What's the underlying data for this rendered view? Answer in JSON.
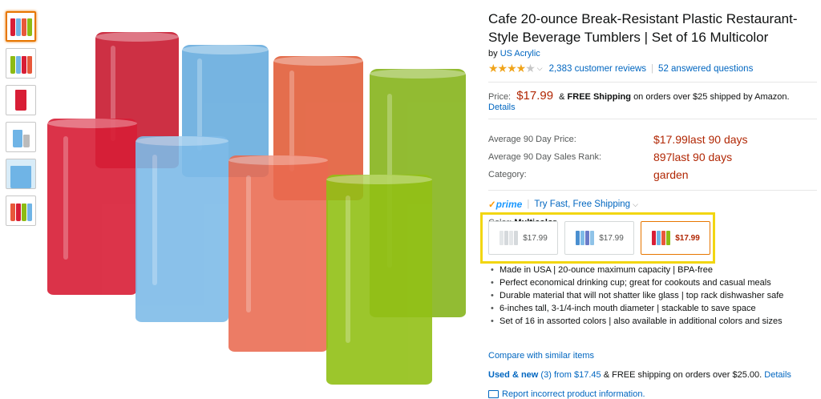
{
  "product": {
    "title": "Cafe 20-ounce Break-Resistant Plastic Restaurant-Style Beverage Tumblers | Set of 16 Multicolor",
    "by_prefix": "by",
    "brand": "US Acrylic",
    "rating_stars": 4,
    "reviews_label": "2,383 customer reviews",
    "questions_label": "52 answered questions"
  },
  "pricing": {
    "price_label": "Price:",
    "price": "$17.99",
    "amp": "&",
    "free_shipping": "FREE Shipping",
    "shipping_note": "on orders over $25 shipped by Amazon.",
    "details_link": "Details"
  },
  "stats": [
    {
      "label": "Average 90 Day Price:",
      "value": "$17.99last 90 days"
    },
    {
      "label": "Average 90 Day Sales Rank:",
      "value": "897last 90 days"
    },
    {
      "label": "Category:",
      "value": "garden"
    }
  ],
  "prime": {
    "logo": "prime",
    "link": "Try Fast, Free Shipping"
  },
  "color": {
    "label": "Color:",
    "selected": "Multicolor",
    "options": [
      {
        "price": "$17.99"
      },
      {
        "price": "$17.99"
      },
      {
        "price": "$17.99"
      }
    ]
  },
  "bullets": [
    "Made in USA | 20-ounce maximum capacity | BPA-free",
    "Perfect economical drinking cup; great for cookouts and casual meals",
    "Durable material that will not shatter like glass | top rack dishwasher safe",
    "6-inches tall, 3-1/4-inch mouth diameter | stackable to save space",
    "Set of 16 in assorted colors | also available in additional colors and sizes"
  ],
  "links": {
    "compare": "Compare with similar items",
    "used_new": "Used & new",
    "used_count": "(3)",
    "used_from": "from $17.45",
    "used_shipping": "& FREE shipping on orders over $25.00.",
    "used_details": "Details",
    "report": "Report incorrect product information."
  },
  "colors": {
    "red": "#d81e36",
    "blue": "#6fb4e6",
    "orange": "#e8583a",
    "green": "#8dbb14",
    "price": "#b12704",
    "link": "#0066c0",
    "highlight": "#f2d611"
  }
}
